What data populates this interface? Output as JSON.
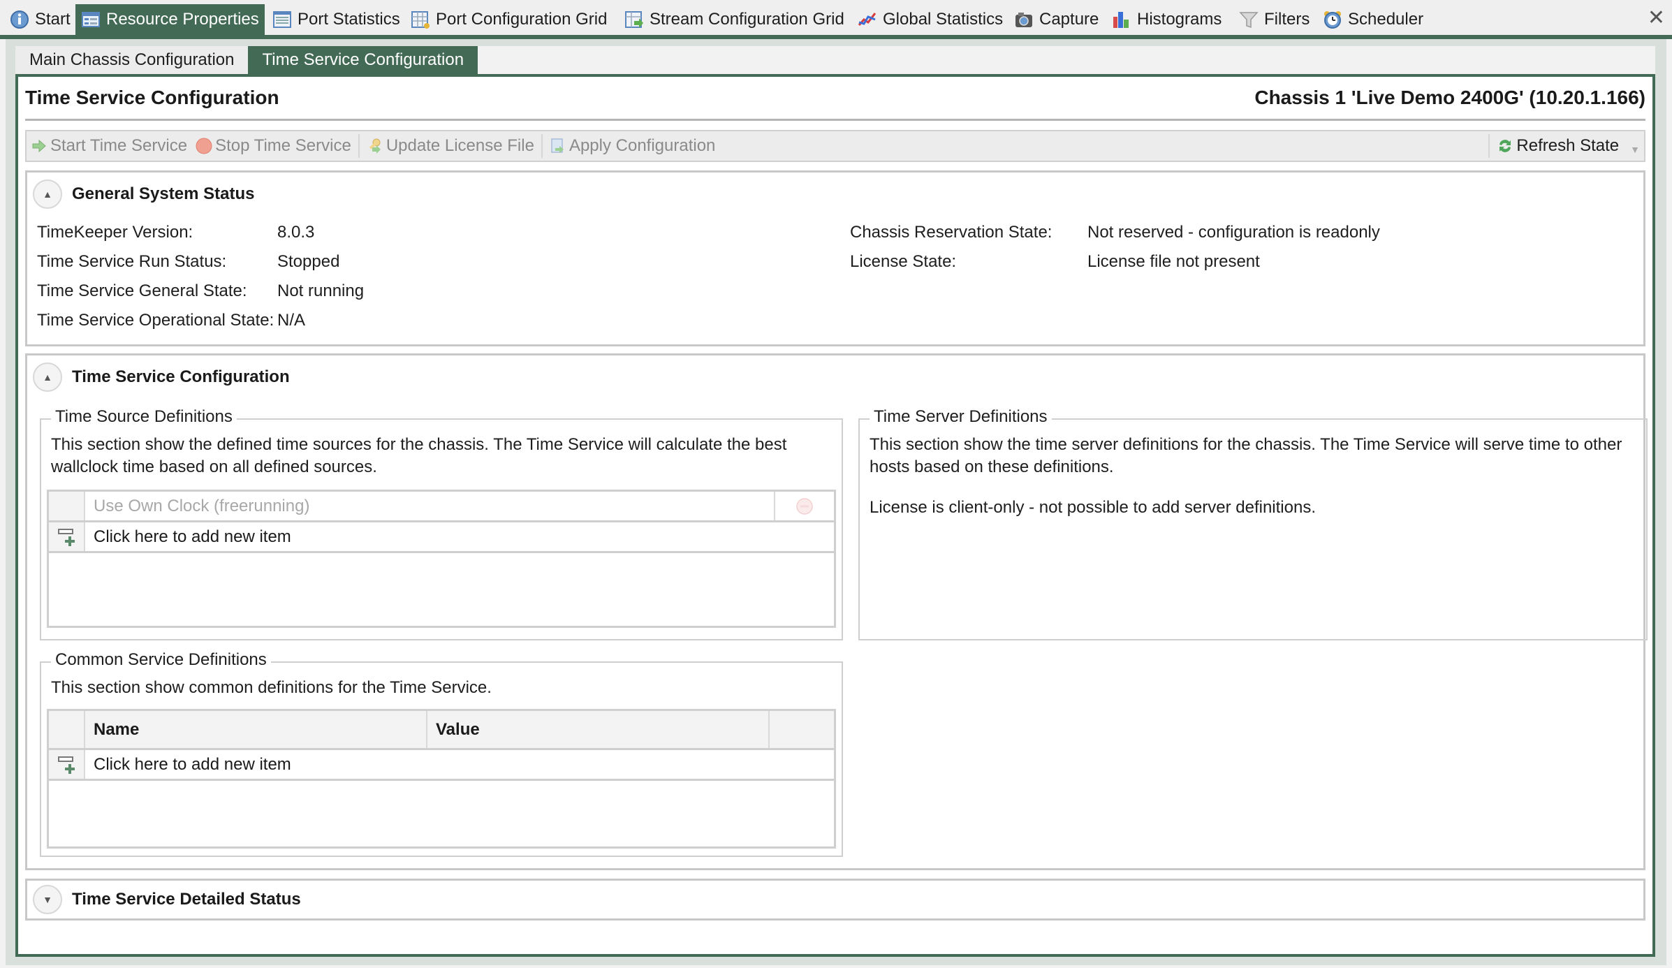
{
  "top_tabs": [
    {
      "label": "Start",
      "icon": "info-icon"
    },
    {
      "label": "Resource Properties",
      "icon": "properties-icon",
      "active": true
    },
    {
      "label": "Port Statistics",
      "icon": "list-icon"
    },
    {
      "label": "Port Configuration Grid",
      "icon": "grid-config-icon"
    },
    {
      "label": "Stream Configuration Grid",
      "icon": "stream-grid-icon"
    },
    {
      "label": "Global Statistics",
      "icon": "line-chart-icon"
    },
    {
      "label": "Capture",
      "icon": "camera-icon"
    },
    {
      "label": "Histograms",
      "icon": "bar-chart-icon"
    },
    {
      "label": "Filters",
      "icon": "funnel-icon"
    },
    {
      "label": "Scheduler",
      "icon": "alarm-clock-icon"
    }
  ],
  "close_glyph": "✕",
  "sub_tabs": [
    {
      "label": "Main Chassis Configuration"
    },
    {
      "label": "Time Service Configuration",
      "active": true
    }
  ],
  "header": {
    "title": "Time Service Configuration",
    "chassis": "Chassis 1 'Live Demo 2400G' (10.20.1.166)"
  },
  "toolbar": {
    "start": "Start Time Service",
    "stop": "Stop Time Service",
    "update_license": "Update License File",
    "apply": "Apply Configuration",
    "refresh": "Refresh State"
  },
  "general_status": {
    "title": "General System Status",
    "left": [
      {
        "label": "TimeKeeper Version:",
        "value": "8.0.3"
      },
      {
        "label": "Time Service Run Status:",
        "value": "Stopped"
      },
      {
        "label": "Time Service General State:",
        "value": "Not running"
      },
      {
        "label": "Time Service Operational State:",
        "value": "N/A"
      }
    ],
    "right": [
      {
        "label": "Chassis Reservation State:",
        "value": "Not reserved - configuration is readonly"
      },
      {
        "label": "License State:",
        "value": "License file not present"
      }
    ]
  },
  "time_service_config": {
    "title": "Time Service Configuration",
    "sources": {
      "legend": "Time Source Definitions",
      "description": "This section show the defined time sources for the chassis. The Time Service will calculate the best wallclock time based on all defined sources.",
      "rows": [
        {
          "value": "Use Own Clock (freerunning)"
        }
      ],
      "add_label": "Click here to add new item"
    },
    "servers": {
      "legend": "Time Server Definitions",
      "description": "This section show the time server definitions for the chassis. The Time Service will serve time to other hosts based on these definitions.",
      "note": "License is client-only - not possible to add server definitions."
    },
    "common": {
      "legend": "Common Service Definitions",
      "description": "This section show common definitions for the Time Service.",
      "columns": [
        "Name",
        "Value"
      ],
      "add_label": "Click here to add new item"
    }
  },
  "detailed_status": {
    "title": "Time Service Detailed Status"
  },
  "expander_up": "▲",
  "expander_down": "▼",
  "colors": {
    "accent": "#426a55",
    "disabled_text": "#8a8a8a"
  }
}
